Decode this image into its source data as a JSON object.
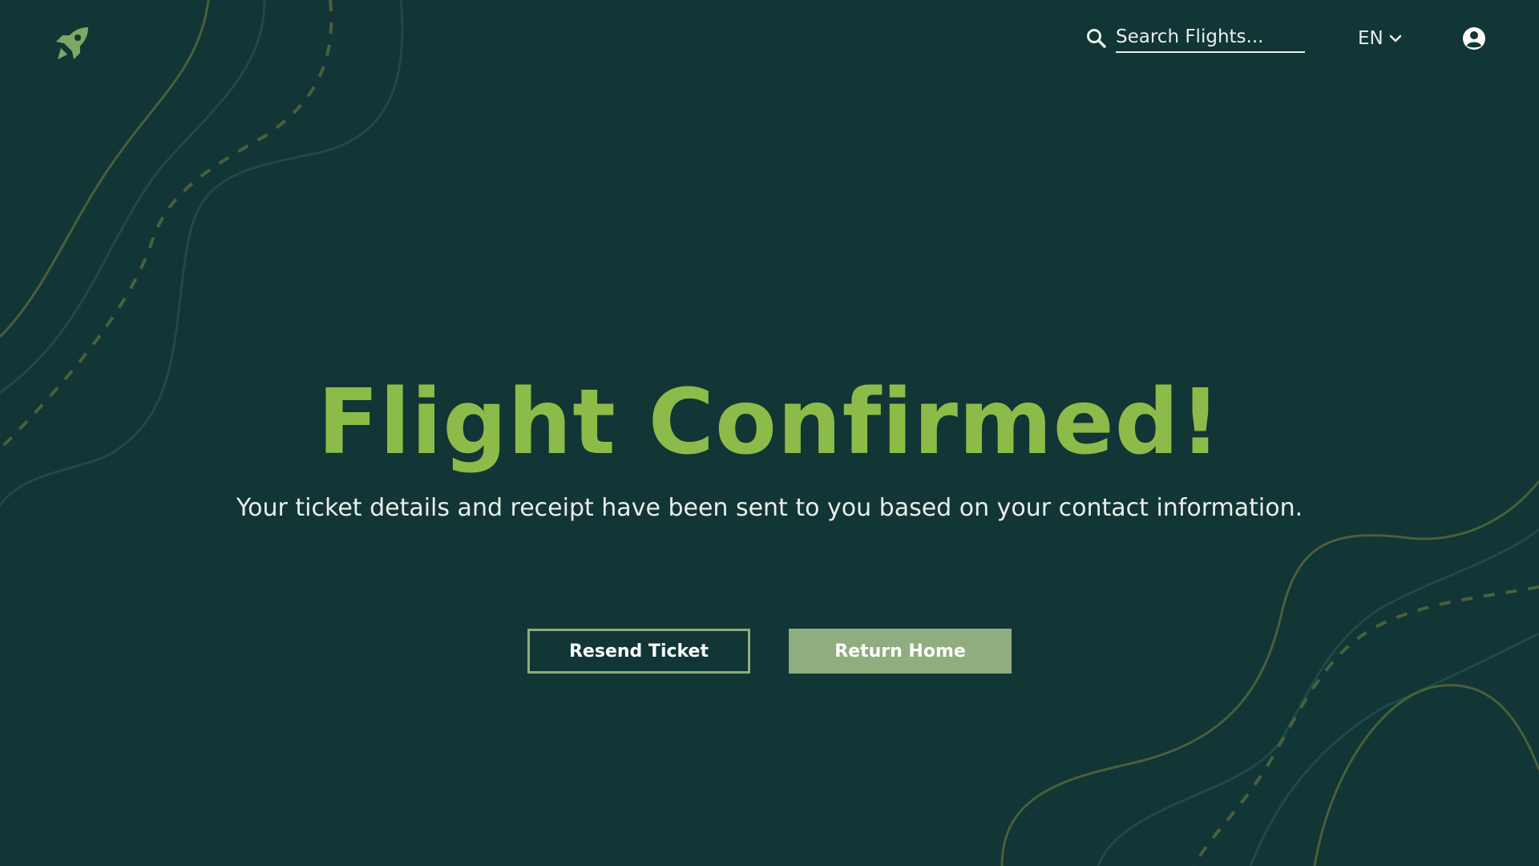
{
  "colors": {
    "background": "#123535",
    "accent_green": "#8dbb49",
    "muted_green": "#8fad7e",
    "text_light": "#e8efe9"
  },
  "header": {
    "logo_icon": "rocket-icon",
    "search": {
      "icon": "search-icon",
      "placeholder": "Search Flights..."
    },
    "language": {
      "label": "EN",
      "icon": "chevron-down-icon"
    },
    "account_icon": "user-circle-icon"
  },
  "hero": {
    "title": "Flight Confirmed!",
    "subtitle": "Your ticket details and receipt have been sent to you based on your contact information."
  },
  "actions": {
    "resend_label": "Resend Ticket",
    "home_label": "Return Home"
  }
}
